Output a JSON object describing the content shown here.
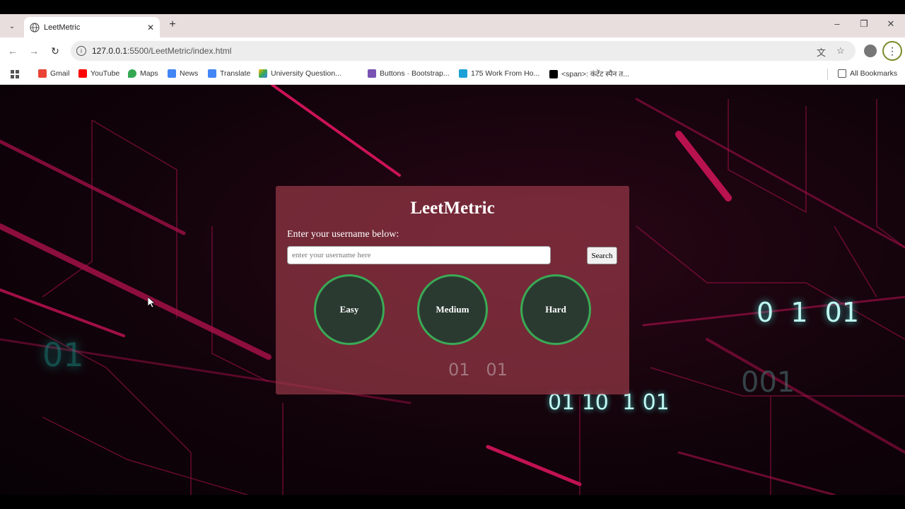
{
  "browser": {
    "tab_title": "LeetMetric",
    "url_host": "127.0.0.1",
    "url_path": ":5500/LeetMetric/index.html"
  },
  "bookmarks": [
    {
      "label": "Gmail",
      "color": "#ea4335"
    },
    {
      "label": "YouTube",
      "color": "#ff0000"
    },
    {
      "label": "Maps",
      "color": "#34a853"
    },
    {
      "label": "News",
      "color": "#4285f4"
    },
    {
      "label": "Translate",
      "color": "#4285f4"
    },
    {
      "label": "University Question...",
      "color": "#fbbc04"
    },
    {
      "label": "Buttons · Bootstrap...",
      "color": "#7952b3"
    },
    {
      "label": "175 Work From Ho...",
      "color": "#1ba1d6"
    },
    {
      "label": "<span>: कंटेंट स्पैन त...",
      "color": "#000000"
    },
    {
      "label": "All Bookmarks",
      "color": "#555555"
    }
  ],
  "app": {
    "heading": "LeetMetric",
    "prompt": "Enter your username below:",
    "input_placeholder": "enter your username here",
    "search_label": "Search",
    "difficulties": [
      "Easy",
      "Medium",
      "Hard"
    ]
  },
  "background_digits": {
    "card_overlay": "01   01",
    "right_top": "0  1  01",
    "right_mid": "001",
    "bottom_row": "01 10  1 01",
    "left": "01"
  },
  "colors": {
    "accent_ring": "#3aaa55",
    "circle_fill": "#2b3a31",
    "digit_glow": "#8ff0ea",
    "line_pink": "#e0155f"
  }
}
